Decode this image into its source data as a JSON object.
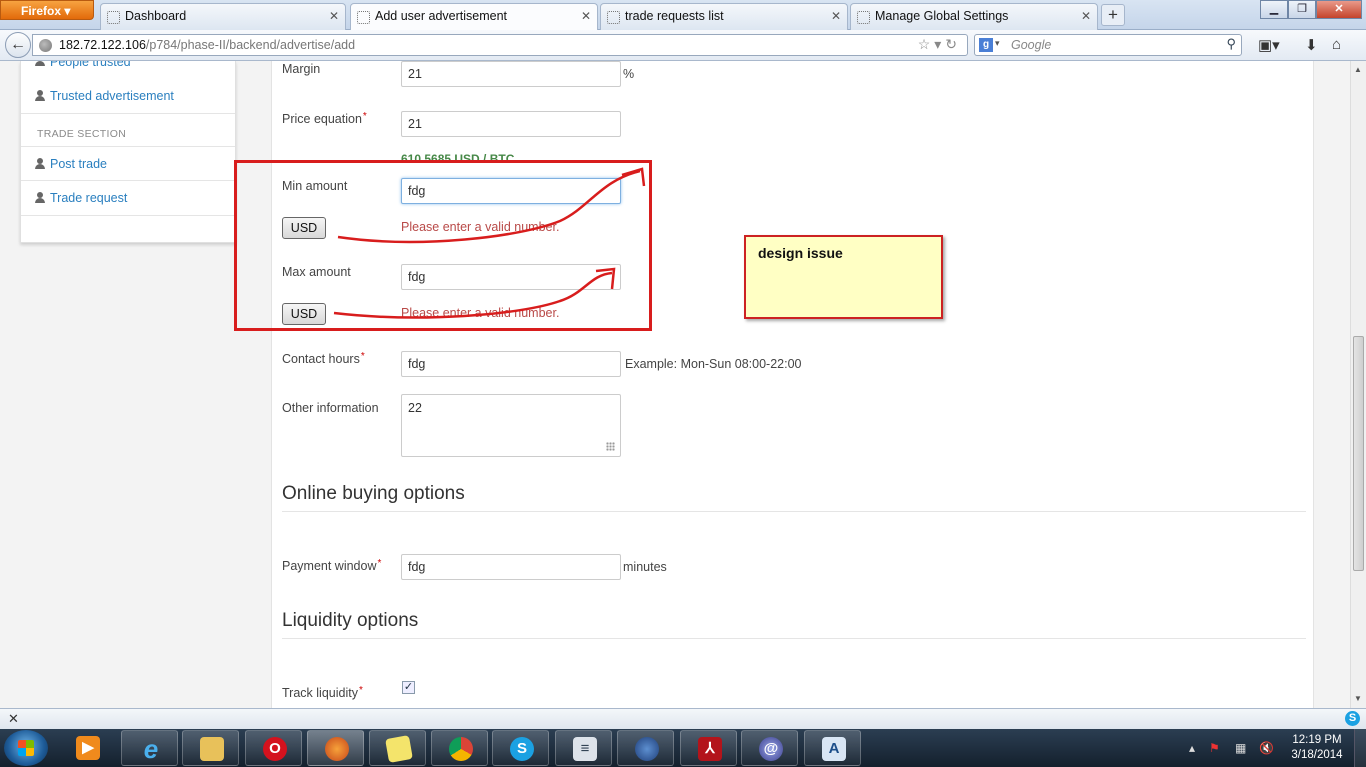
{
  "browser": {
    "app_button": "Firefox",
    "tabs": [
      {
        "label": "Dashboard"
      },
      {
        "label": "Add user advertisement"
      },
      {
        "label": "trade requests list"
      },
      {
        "label": "Manage Global Settings"
      }
    ],
    "url_host": "182.72.122.106",
    "url_path": "/p784/phase-II/backend/advertise/add",
    "search_placeholder": "Google"
  },
  "sidebar": {
    "cut_item": "People trusted",
    "items": [
      {
        "label": "Trusted advertisement"
      },
      {
        "label": "Post trade"
      },
      {
        "label": "Trade request"
      }
    ],
    "section_header": "TRADE SECTION"
  },
  "form": {
    "margin": {
      "label": "Margin",
      "value": "21",
      "suffix": "%"
    },
    "price_equation": {
      "label": "Price equation",
      "required": "*",
      "value": "21",
      "rate": "610.5685 USD / BTC"
    },
    "min_amount": {
      "label": "Min amount",
      "value": "fdg",
      "currency": "USD",
      "error": "Please enter a valid number."
    },
    "max_amount": {
      "label": "Max amount",
      "value": "fdg",
      "currency": "USD",
      "error": "Please enter a valid number."
    },
    "contact_hours": {
      "label": "Contact hours",
      "required": "*",
      "value": "fdg",
      "hint": "Example: Mon-Sun 08:00-22:00"
    },
    "other_information": {
      "label": "Other information",
      "value": "22"
    },
    "online_buying_title": "Online buying options",
    "payment_window": {
      "label": "Payment window",
      "required": "*",
      "value": "fdg",
      "suffix": "minutes"
    },
    "liquidity_title": "Liquidity options",
    "track_liquidity": {
      "label": "Track liquidity",
      "required": "*",
      "checked": true
    }
  },
  "annotation": {
    "note_text": "design issue",
    "color": "#d81d1d"
  },
  "taskbar": {
    "time": "12:19 PM",
    "date": "3/18/2014"
  }
}
